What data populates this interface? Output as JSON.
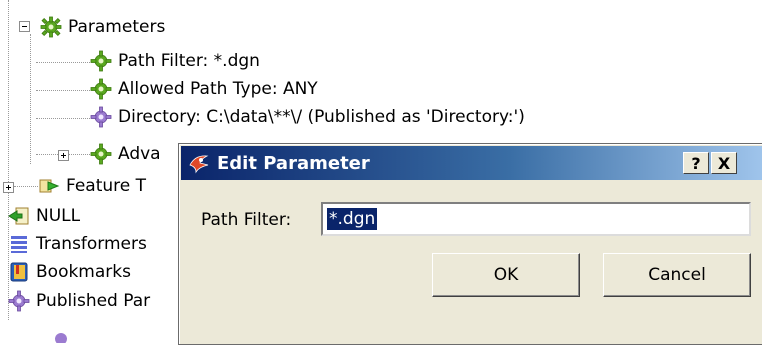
{
  "tree": {
    "parameters": "Parameters",
    "path_filter": "Path Filter: *.dgn",
    "allowed_path_type": "Allowed Path Type: ANY",
    "directory": "Directory: C:\\data\\**\\/ (Published as 'Directory:')",
    "advanced": "Adva",
    "feature_types": "Feature T",
    "null": "NULL",
    "transformers": "Transformers",
    "bookmarks": "Bookmarks",
    "published_parameters": "Published Par"
  },
  "dialog": {
    "title": "Edit Parameter",
    "help_label": "?",
    "close_label": "X",
    "field_label": "Path Filter:",
    "field_value": "*.dgn",
    "ok_label": "OK",
    "cancel_label": "Cancel"
  },
  "colors": {
    "title_bar_start": "#0a246a",
    "title_bar_end": "#a6caf0",
    "dialog_face": "#ece9d8",
    "selection": "#0a246a"
  },
  "icons": {
    "parameter": "green-gear-icon",
    "published": "purple-gear-icon",
    "feature_types": "arrow-icon",
    "null": "null-icon",
    "transformers": "list-icon",
    "bookmarks": "book-icon",
    "logo": "fme-logo-icon"
  }
}
